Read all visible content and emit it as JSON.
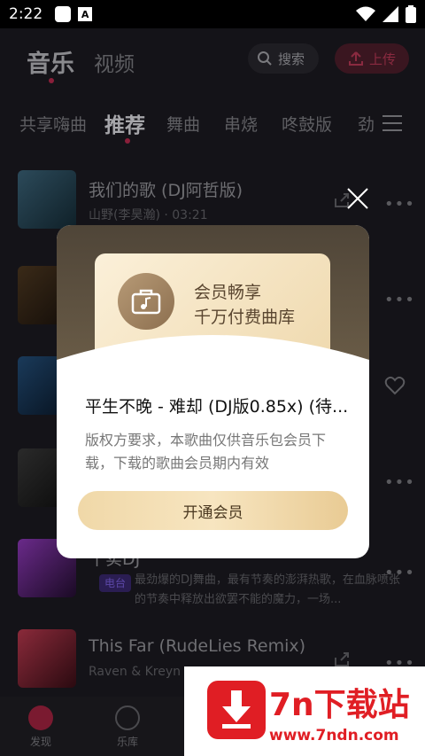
{
  "status_bar": {
    "time": "2:22",
    "a_badge": "A"
  },
  "header": {
    "tab_music": "音乐",
    "tab_video": "视频",
    "search_label": "搜索",
    "upload_label": "上传"
  },
  "category_tabs": [
    "共享嗨曲",
    "推荐",
    "舞曲",
    "串烧",
    "咚鼓版",
    "劲"
  ],
  "active_category": "推荐",
  "songs": [
    {
      "title": "我们的歌 (DJ阿哲版)",
      "sub": "山野(李昊瀚) · 03:21"
    },
    {
      "title": "",
      "sub": ""
    },
    {
      "title": "",
      "sub": ""
    },
    {
      "title": "",
      "sub": ""
    },
    {
      "title": "十实DJ",
      "badge": "电台",
      "desc": "最劲爆的DJ舞曲，最有节奏的澎湃热歌，在血脉喷张的节奏中释放出欲罢不能的魔力，一场..."
    },
    {
      "title": "This Far (RudeLies Remix)",
      "sub": "Raven & Kreyn"
    }
  ],
  "bottom_nav": [
    {
      "label": "发现"
    },
    {
      "label": "乐库"
    }
  ],
  "modal": {
    "card_line1": "会员畅享",
    "card_line2": "千万付费曲库",
    "song_title": "平生不晚 - 难却 (DJ版0.85x) (待...",
    "desc": "版权方要求，本歌曲仅供音乐包会员下载，下载的歌曲会员期内有效",
    "button": "开通会员"
  },
  "watermark": {
    "line1": "7n下载站",
    "line2": "www.7ndn.com"
  },
  "colors": {
    "accent": "#e01e24",
    "gold": "#efd9ae",
    "dark_bg": "#141318"
  }
}
